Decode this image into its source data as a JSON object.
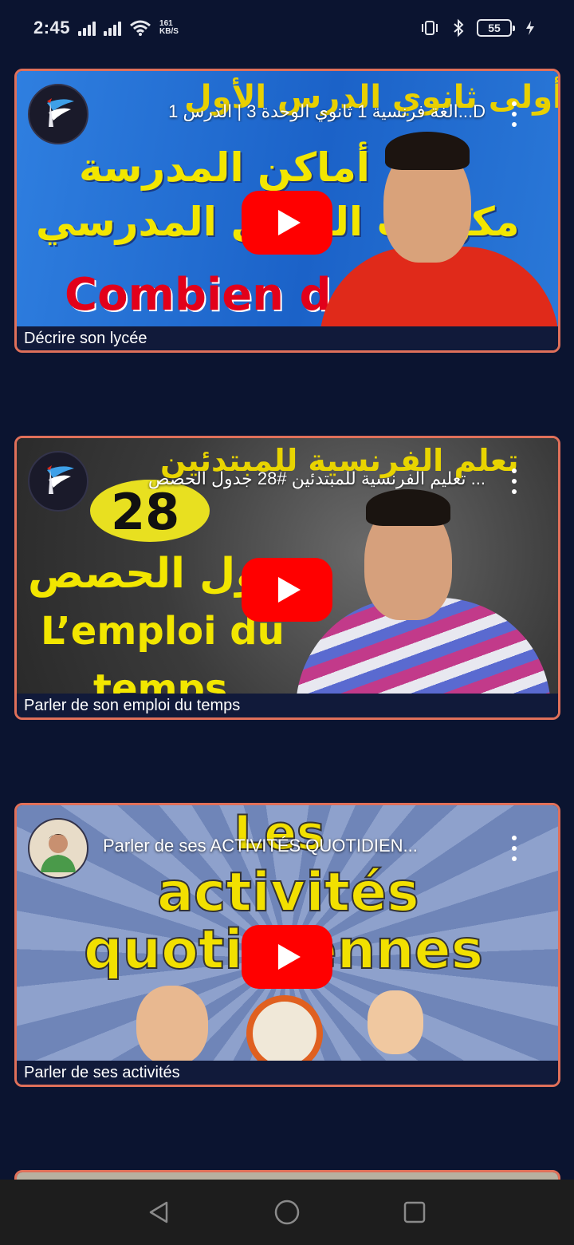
{
  "status_bar": {
    "time": "2:45",
    "net_speed_value": "161",
    "net_speed_unit": "KB/S",
    "battery_level": "55"
  },
  "videos": [
    {
      "title": "D...الغة فرنسية 1 ثانوي الوحدة 3 | الدرس 1",
      "caption": "Décrire son lycée",
      "channel_icon": "channel-logo-icon",
      "thumb_lines": [
        "أولى ثانوي الدرس الأول",
        "أماكن المدرسة",
        "مكونات الفصل المدرسي",
        "Combien de"
      ]
    },
    {
      "title": "... تعليم الفرنسية للمبتدئين #28 جدول الحصص",
      "caption": "Parler de son emploi du temps",
      "channel_icon": "channel-logo-icon",
      "thumb_lines": [
        "تعلم الفرنسية للمبتدئين",
        "28",
        "جدول الحصص",
        "L’emploi du",
        "temps"
      ]
    },
    {
      "title": "Parler de ses ACTIVITÉS QUOTIDIEN...",
      "caption": "Parler de ses activités",
      "channel_icon": "channel-avatar-photo",
      "thumb_lines": [
        "Les",
        "activités",
        "quotidiennes"
      ]
    }
  ],
  "colors": {
    "background": "#0b1430",
    "card_border": "#e0705a",
    "play_button": "#ff0000"
  }
}
